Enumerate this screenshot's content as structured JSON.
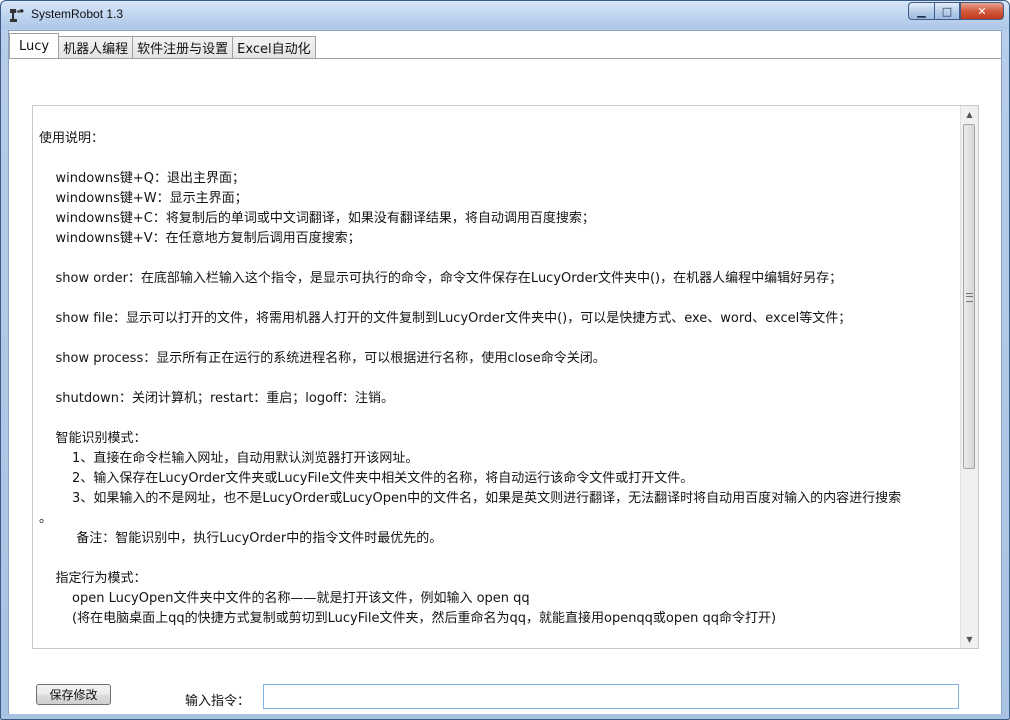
{
  "window": {
    "title": "SystemRobot 1.3",
    "controls": {
      "minimize": "▁",
      "maximize": "□",
      "close": "✕"
    }
  },
  "tabs": [
    {
      "label": "Lucy",
      "active": true
    },
    {
      "label": "机器人编程",
      "active": false
    },
    {
      "label": "软件注册与设置",
      "active": false
    },
    {
      "label": "Excel自动化",
      "active": false
    }
  ],
  "instructions": {
    "lines": [
      "使用说明：",
      "",
      "    windowns键+Q：退出主界面；",
      "    windowns键+W：显示主界面；",
      "    windowns键+C：将复制后的单词或中文词翻译，如果没有翻译结果，将自动调用百度搜索；",
      "    windowns键+V：在任意地方复制后调用百度搜索；",
      "",
      "    show order：在底部输入栏输入这个指令，是显示可执行的命令，命令文件保存在LucyOrder文件夹中()，在机器人编程中编辑好另存；",
      "",
      "    show file：显示可以打开的文件，将需用机器人打开的文件复制到LucyOrder文件夹中()，可以是快捷方式、exe、word、excel等文件；",
      "",
      "    show process：显示所有正在运行的系统进程名称，可以根据进行名称，使用close命令关闭。",
      "",
      "    shutdown：关闭计算机；restart：重启；logoff：注销。",
      "",
      "    智能识别模式：",
      "        1、直接在命令栏输入网址，自动用默认浏览器打开该网址。",
      "        2、输入保存在LucyOrder文件夹或LucyFile文件夹中相关文件的名称，将自动运行该命令文件或打开文件。",
      "        3、如果输入的不是网址，也不是LucyOrder或LucyOpen中的文件名，如果是英文则进行翻译，无法翻译时将自动用百度对输入的内容进行搜索",
      "。",
      "         备注：智能识别中，执行LucyOrder中的指令文件时最优先的。",
      "",
      "    指定行为模式：",
      "        open LucyOpen文件夹中文件的名称——就是打开该文件，例如输入 open qq",
      "        (将在电脑桌面上qq的快捷方式复制或剪切到LucyFile文件夹，然后重命名为qq，就能直接用openqq或open qq命令打开)"
    ]
  },
  "footer": {
    "save_button": "保存修改",
    "command_label": "输入指令：",
    "command_value": ""
  }
}
